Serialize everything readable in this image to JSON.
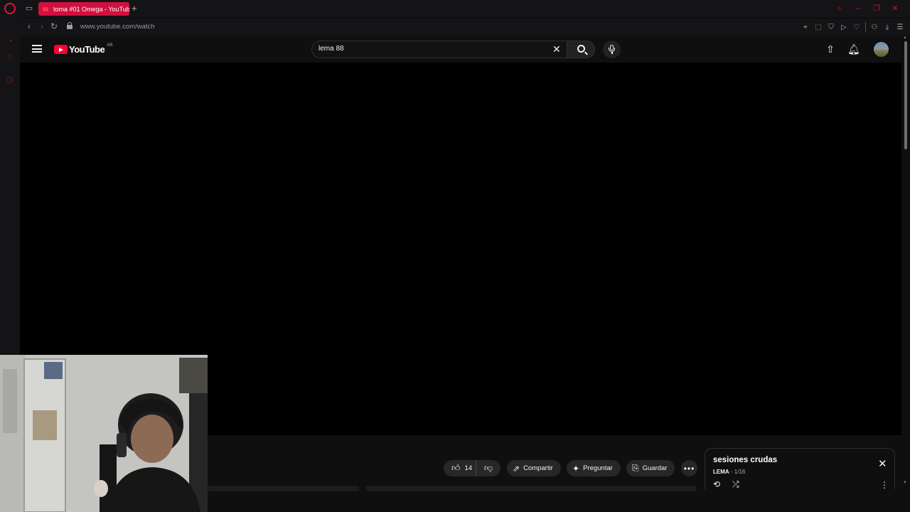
{
  "browser": {
    "tab_title": "toma #01 Omega - YouTube",
    "new_tab": "+",
    "url": "www.youtube.com/watch"
  },
  "youtube": {
    "logo_text": "YouTube",
    "region": "AR",
    "search_value": "lema 88"
  },
  "actions": {
    "likes": "14",
    "share": "Compartir",
    "ask": "Preguntar",
    "save": "Guardar"
  },
  "playlist": {
    "title": "sesiones crudas",
    "channel": "LEMA",
    "position": " - 1/16"
  },
  "colors": {
    "brand_red": "#ff0033",
    "opera_red": "#d0103f",
    "background": "#0f0f0f"
  }
}
